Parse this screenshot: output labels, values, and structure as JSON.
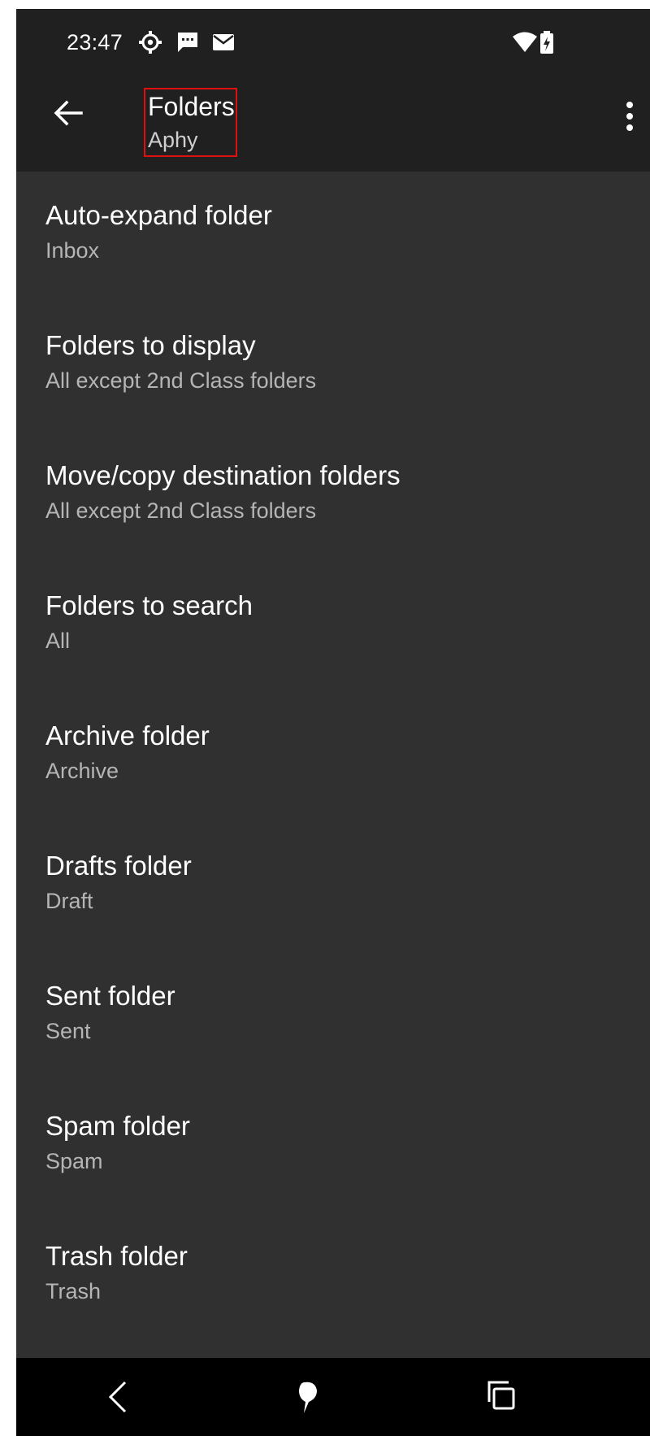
{
  "status_bar": {
    "time": "23:47",
    "icons_left": [
      "settings-gear-icon",
      "sms-message-icon",
      "email-icon"
    ],
    "icons_right": [
      "wifi-icon",
      "battery-charging-icon"
    ]
  },
  "app_bar": {
    "title": "Folders",
    "subtitle": "Aphy",
    "back_icon": "arrow-left-icon",
    "menu_icon": "more-vertical-icon"
  },
  "preferences": [
    {
      "title": "Auto-expand folder",
      "summary": "Inbox"
    },
    {
      "title": "Folders to display",
      "summary": "All except 2nd Class folders"
    },
    {
      "title": "Move/copy destination folders",
      "summary": "All except 2nd Class folders"
    },
    {
      "title": "Folders to search",
      "summary": "All"
    },
    {
      "title": "Archive folder",
      "summary": "Archive"
    },
    {
      "title": "Drafts folder",
      "summary": "Draft"
    },
    {
      "title": "Sent folder",
      "summary": "Sent"
    },
    {
      "title": "Spam folder",
      "summary": "Spam"
    },
    {
      "title": "Trash folder",
      "summary": "Trash"
    }
  ],
  "nav_bar": {
    "icons": [
      "nav-back-icon",
      "nav-home-icon",
      "nav-recents-icon"
    ]
  },
  "colors": {
    "background": "#303030",
    "app_bar": "#202020",
    "nav_bar": "#000000",
    "highlight_box": "#e01010"
  }
}
